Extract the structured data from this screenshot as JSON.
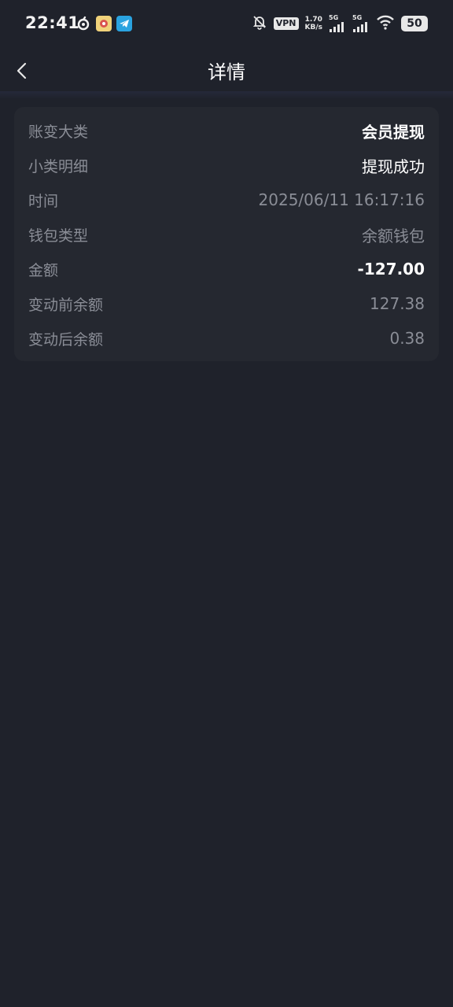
{
  "status_bar": {
    "time": "22:41",
    "vpn": "VPN",
    "net_speed_value": "1.70",
    "net_speed_unit": "KB/s",
    "signal1_label": "5G",
    "signal2_label": "5G",
    "battery": "50"
  },
  "nav": {
    "title": "详情"
  },
  "detail": {
    "rows": [
      {
        "label": "账变大类",
        "value": "会员提现",
        "style": "strong"
      },
      {
        "label": "小类明细",
        "value": "提现成功",
        "style": "white"
      },
      {
        "label": "时间",
        "value": "2025/06/11 16:17:16",
        "style": "muted"
      },
      {
        "label": "钱包类型",
        "value": "余额钱包",
        "style": "muted"
      },
      {
        "label": "金额",
        "value": "-127.00",
        "style": "strong"
      },
      {
        "label": "变动前余额",
        "value": "127.38",
        "style": "muted"
      },
      {
        "label": "变动后余额",
        "value": "0.38",
        "style": "muted"
      }
    ]
  },
  "colors": {
    "background": "#1f222b",
    "card": "#252830",
    "muted_text": "#8a8d96",
    "strong_text": "#ffffff"
  }
}
